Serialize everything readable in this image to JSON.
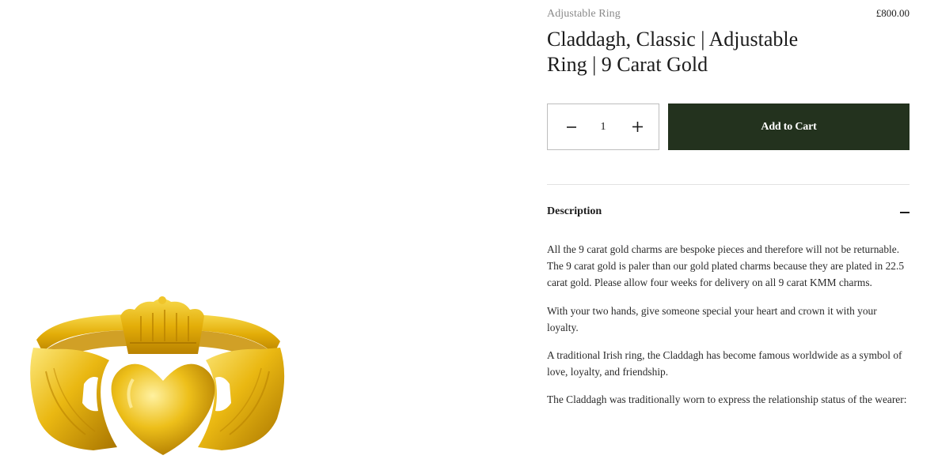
{
  "product": {
    "category": "Adjustable Ring",
    "price": "£800.00",
    "title": "Claddagh, Classic | Adjustable Ring | 9 Carat Gold",
    "image_alt": "Gold Claddagh ring"
  },
  "quantity": {
    "value": "1",
    "decrement_icon": "minus-icon",
    "increment_icon": "plus-icon"
  },
  "cart": {
    "add_label": "Add to Cart"
  },
  "description": {
    "heading": "Description",
    "toggle_icon": "minus-icon",
    "paragraphs": [
      "All the 9 carat gold charms are bespoke pieces and therefore will not be returnable. The 9 carat gold is paler than our gold plated charms because they are plated in 22.5 carat gold.  Please allow four weeks for delivery on all 9 carat KMM charms.",
      "With your two hands, give someone special your heart and crown it with your loyalty.",
      "A traditional Irish ring, the Claddagh has become famous worldwide as a symbol of love, loyalty, and friendship.",
      "The Claddagh was traditionally worn to express the relationship status of the wearer:"
    ]
  },
  "colors": {
    "accent": "#23321e",
    "gold": "#e8b80e"
  }
}
